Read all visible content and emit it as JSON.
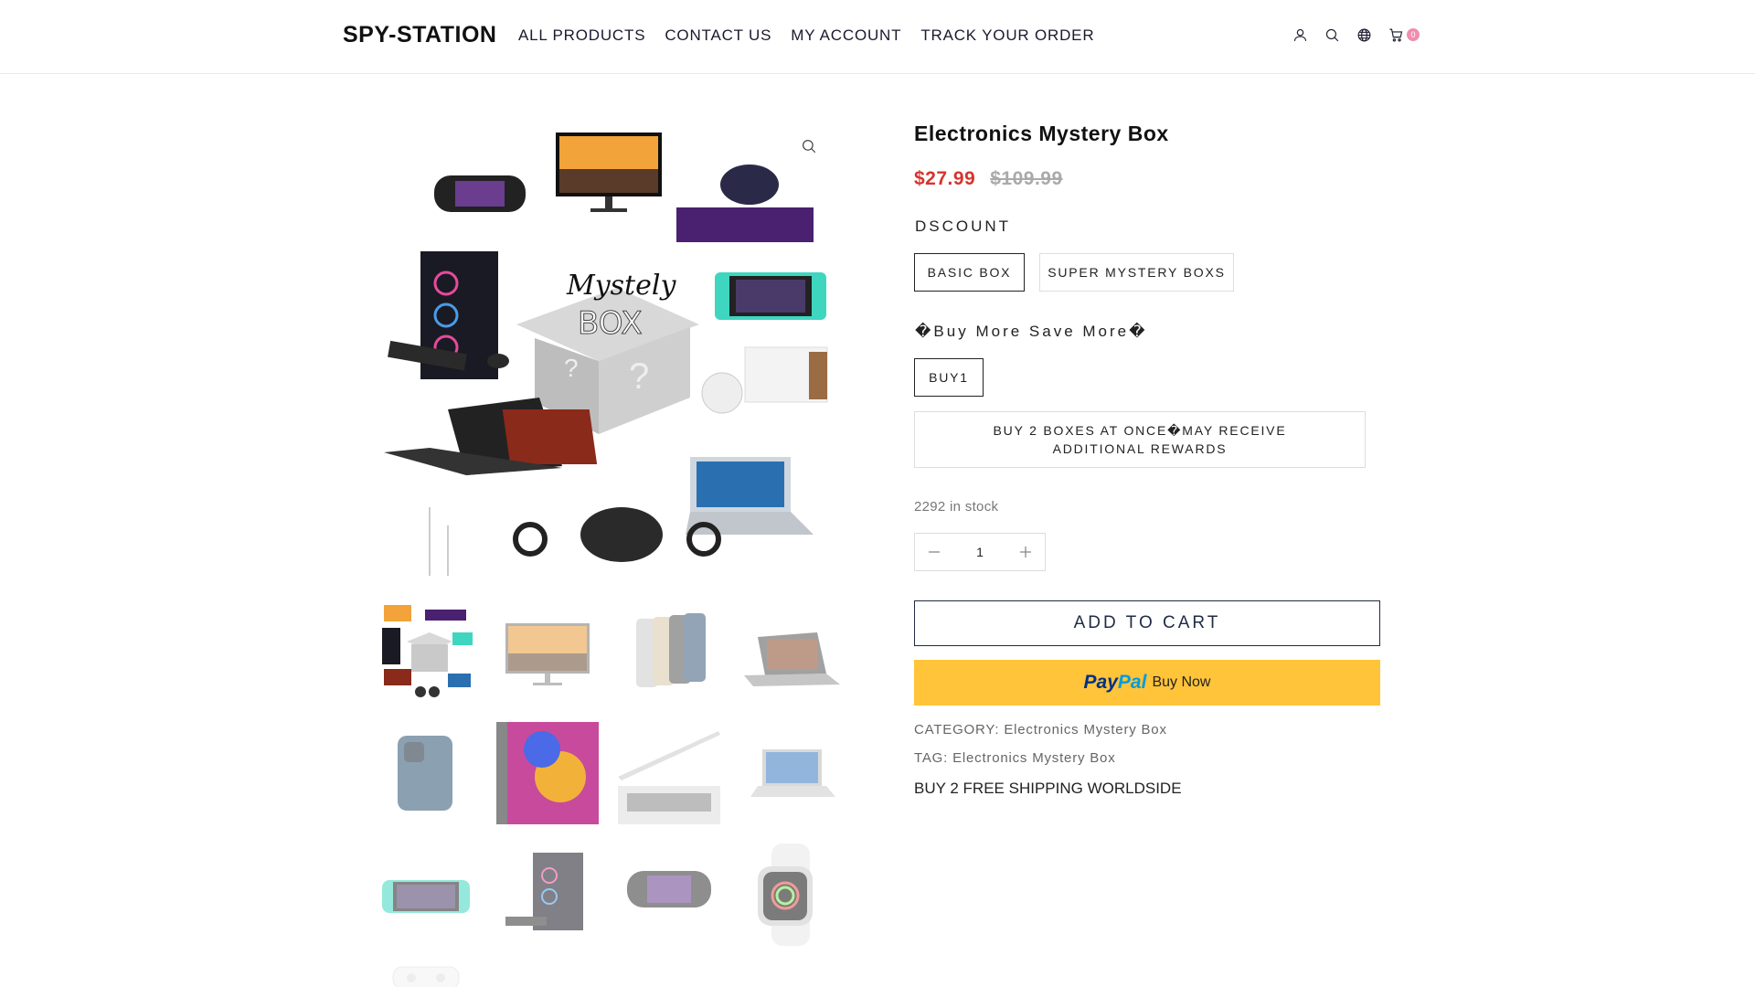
{
  "header": {
    "logo": "SPY-STATION",
    "nav": [
      "ALL PRODUCTS",
      "CONTACT US",
      "MY ACCOUNT",
      "TRACK YOUR ORDER"
    ],
    "cart_count": "0",
    "icons": [
      "user-icon",
      "search-icon",
      "globe-icon",
      "cart-icon"
    ]
  },
  "gallery": {
    "main_image_alt": "Mystely BOX",
    "thumbnail_count": 13
  },
  "product": {
    "title": "Electronics Mystery Box",
    "price_sale": "$27.99",
    "price_old": "$109.99",
    "option1_label": "DSCOUNT",
    "option1_values": [
      "BASIC BOX",
      "SUPER MYSTERY BOXS"
    ],
    "option1_selected": "BASIC BOX",
    "option2_label": "�Buy More Save More�",
    "option2_values": [
      "BUY1",
      "BUY 2 BOXES AT ONCE�MAY RECEIVE ADDITIONAL REWARDS"
    ],
    "option2_selected": "BUY1",
    "stock": "2292 in stock",
    "quantity": "1",
    "add_to_cart": "ADD TO CART",
    "paypal_pay": "Pay",
    "paypal_pal": "Pal",
    "paypal_text": "Buy Now",
    "category_label": "CATEGORY:",
    "category_value": "Electronics Mystery Box",
    "tag_label": "TAG:",
    "tag_value": "Electronics Mystery Box",
    "shipping_note": "BUY 2 FREE SHIPPING WORLDSIDE"
  },
  "colors": {
    "sale_price": "#d6332f",
    "paypal_yellow": "#ffc439",
    "cart_badge": "#f08db0"
  }
}
